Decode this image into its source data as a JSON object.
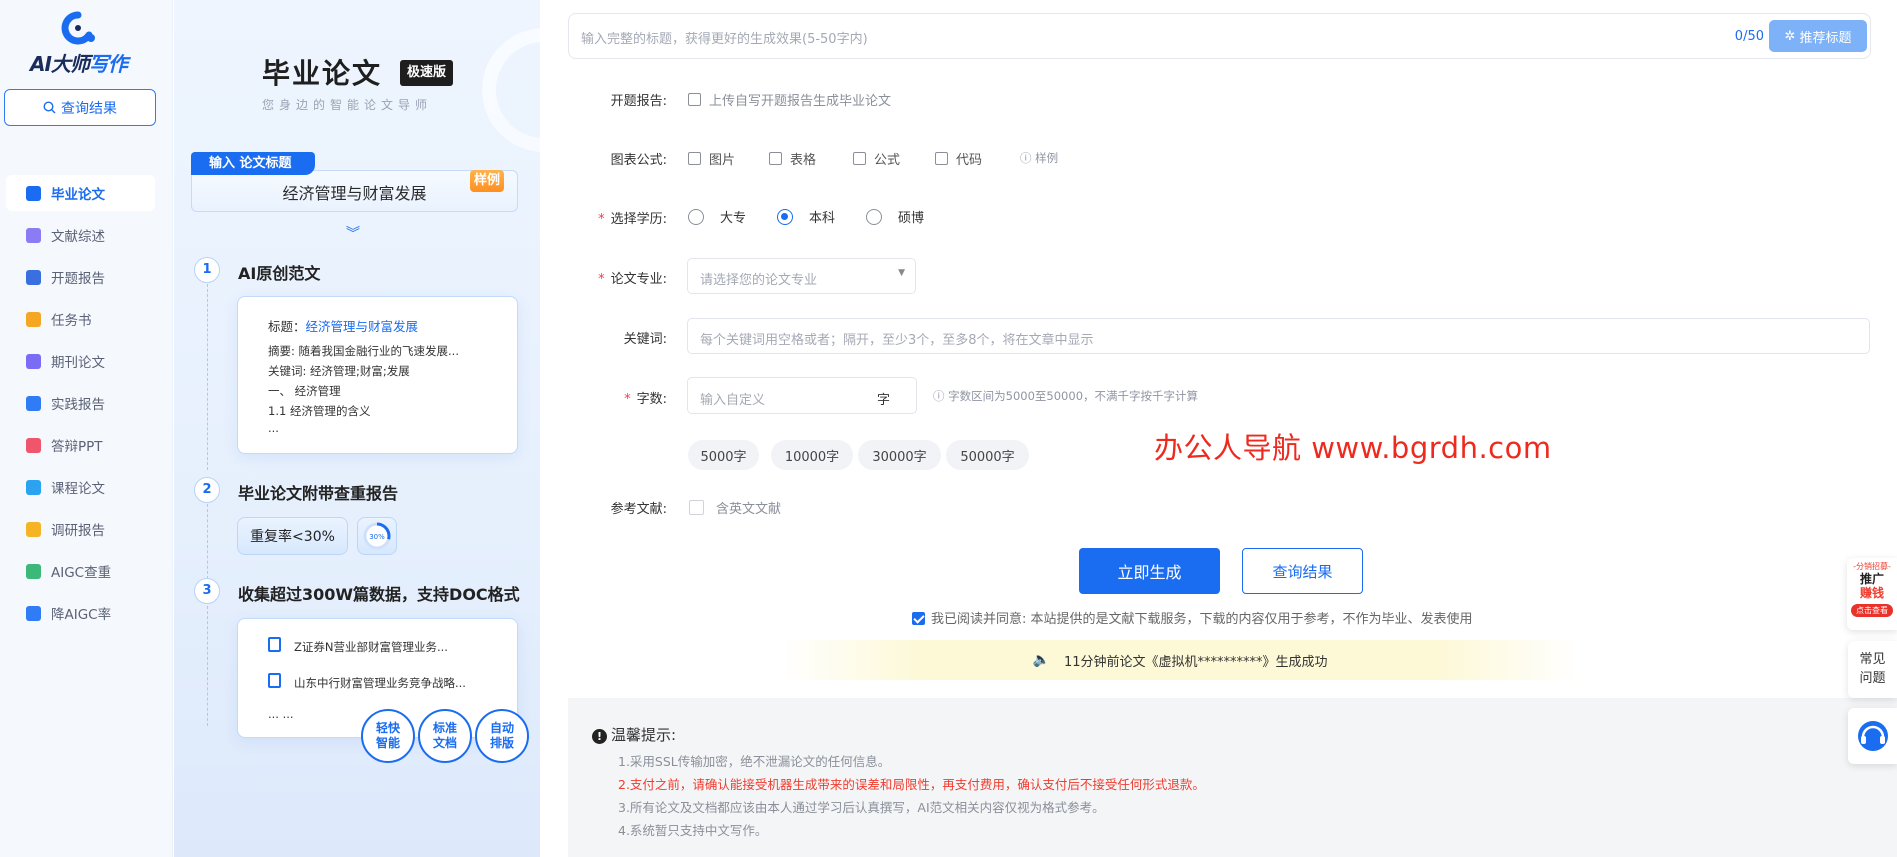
{
  "brand": {
    "logo_text_a": "AI大师",
    "logo_text_b": "写作"
  },
  "sidebar": {
    "query_label": "查询结果",
    "items": [
      {
        "label": "毕业论文",
        "icon": "graduation-cap-icon",
        "color": "#1a6cf0",
        "active": true
      },
      {
        "label": "文献综述",
        "icon": "document-list-icon",
        "color": "#8b7cf6"
      },
      {
        "label": "开题报告",
        "icon": "report-icon",
        "color": "#3a6fe0"
      },
      {
        "label": "任务书",
        "icon": "task-icon",
        "color": "#f5a623"
      },
      {
        "label": "期刊论文",
        "icon": "journal-icon",
        "color": "#7b6cf6"
      },
      {
        "label": "实践报告",
        "icon": "practice-icon",
        "color": "#2f7cf6"
      },
      {
        "label": "答辩PPT",
        "icon": "ppt-icon",
        "color": "#f0566b"
      },
      {
        "label": "课程论文",
        "icon": "course-icon",
        "color": "#2aa3f0"
      },
      {
        "label": "调研报告",
        "icon": "survey-icon",
        "color": "#f5b423"
      },
      {
        "label": "AIGC查重",
        "icon": "aigc-check-icon",
        "color": "#3cb878"
      },
      {
        "label": "降AIGC率",
        "icon": "aigc-reduce-icon",
        "color": "#2f7cf6"
      }
    ]
  },
  "promo": {
    "title": "毕业论文",
    "badge": "极速版",
    "subtitle": "您身边的智能论文导师",
    "sample_tab": "输入 论文标题",
    "sample_title": "经济管理与财富发展",
    "sample_tag": "样例",
    "steps": [
      {
        "num": "1",
        "title": "AI原创范文"
      },
      {
        "num": "2",
        "title": "毕业论文附带查重报告"
      },
      {
        "num": "3",
        "title": "收集超过300W篇数据，支持DOC格式"
      }
    ],
    "card1": {
      "title_label": "标题：",
      "title_value": "经济管理与财富发展",
      "abstract": "摘要: 随着我国金融行业的飞速发展...",
      "keywords": "关键词: 经济管理;财富;发展",
      "h1": "一、 经济管理",
      "h2": "1.1 经济管理的含义",
      "more": "..."
    },
    "dup_rate": "重复率<30%",
    "dup_ring": "30%",
    "card3": {
      "item1": "Z证券N营业部财富管理业务...",
      "item2": "山东中行财富管理业务竞争战略...",
      "more": "... ...",
      "badges": [
        "轻快智能",
        "标准文档",
        "自动排版"
      ]
    }
  },
  "form": {
    "title_placeholder": "输入完整的标题，获得更好的生成效果(5-50字内)",
    "counter": "0/50",
    "recommend_label": "推荐标题",
    "proposal_label": "开题报告:",
    "proposal_option": "上传自写开题报告生成毕业论文",
    "chart_label": "图表公式:",
    "chart_options": [
      "图片",
      "表格",
      "公式",
      "代码"
    ],
    "chart_sample": "样例",
    "edu_label": "选择学历:",
    "edu_options": [
      "大专",
      "本科",
      "硕博"
    ],
    "edu_selected": "本科",
    "major_label": "论文专业:",
    "major_placeholder": "请选择您的论文专业",
    "keyword_label": "关键词:",
    "keyword_placeholder": "每个关键词用空格或者；隔开，至少3个，至多8个，将在文章中显示",
    "wordcount_label": "字数:",
    "wordcount_placeholder": "输入自定义",
    "wordcount_unit": "字",
    "wordcount_hint": "字数区间为5000至50000，不满千字按千字计算",
    "wordcount_presets": [
      "5000字",
      "10000字",
      "30000字",
      "50000字"
    ],
    "ref_label": "参考文献:",
    "ref_option": "含英文文献",
    "generate_label": "立即生成",
    "query_label": "查询结果",
    "agree_text": "我已阅读并同意: 本站提供的是文献下载服务，下载的内容仅用于参考，不作为毕业、发表使用",
    "notice": "11分钟前论文《虚拟机**********》生成成功"
  },
  "watermark": "办公人导航 www.bgrdh.com",
  "tips": {
    "title": "温馨提示:",
    "items": [
      "1.采用SSL传输加密，绝不泄漏论文的任何信息。",
      "2.支付之前，请确认能接受机器生成带来的误差和局限性，再支付费用，确认支付后不接受任何形式退款。",
      "3.所有论文及文档都应该由本人通过学习后认真撰写，AI范文相关内容仅视为格式参考。",
      "4.系统暂只支持中文写作。"
    ]
  },
  "floats": {
    "promo_top": "-分销招募-",
    "promo_mid1": "推广",
    "promo_mid2": "赚钱",
    "promo_bottom": "点击查看",
    "faq": "常见问题"
  },
  "colors": {
    "accent": "#1a6cf0",
    "warning": "#f03c2e"
  }
}
